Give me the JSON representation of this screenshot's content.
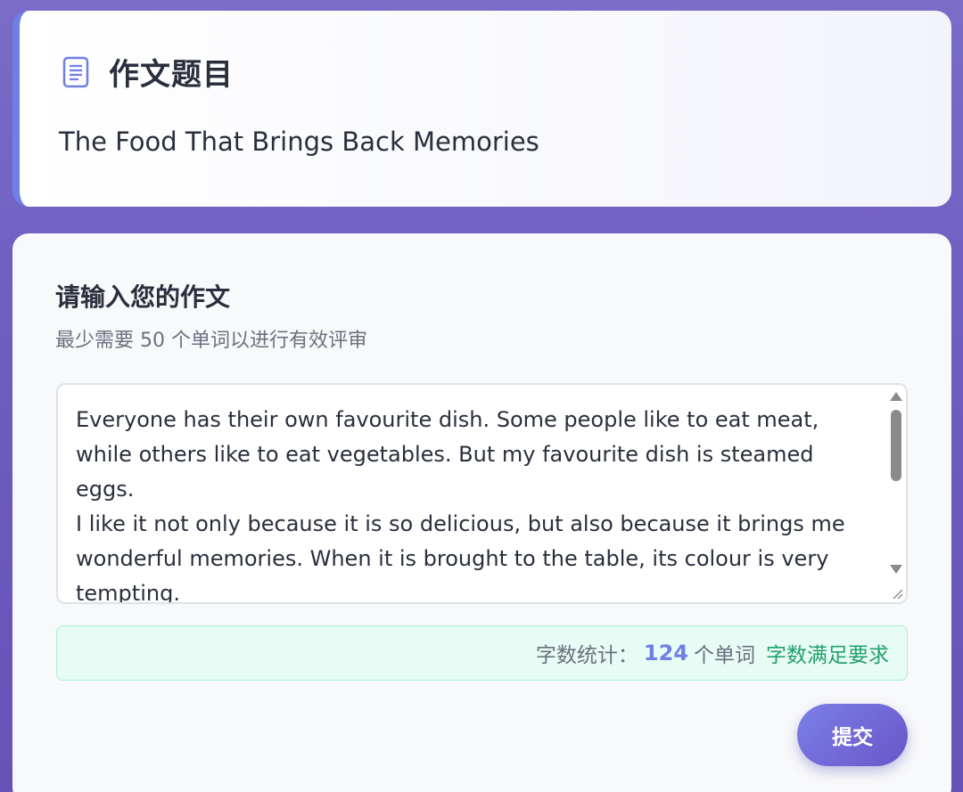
{
  "topic_card": {
    "heading": "作文题目",
    "topic": "The Food That Brings Back Memories",
    "icon": "document-icon"
  },
  "essay_card": {
    "title": "请输入您的作文",
    "hint": "最少需要 50 个单词以进行有效评审",
    "essay_text": "Everyone has their own favourite dish. Some people like to eat meat, while others like to eat vegetables. But my favourite dish is steamed eggs.\nI like it not only because it is so delicious, but also because it brings me wonderful memories. When it is brought to the table, its colour is very tempting.\nWhen I was little, my mum would make steamed eggs for me every morning",
    "word_count": {
      "label": "字数统计：",
      "count": "124",
      "unit": "个单词",
      "status": "字数满足要求"
    },
    "submit_label": "提交"
  },
  "colors": {
    "accent": "#6f7fe6",
    "success": "#22a06b",
    "background_gradient": [
      "#7a6cc8",
      "#6752b8"
    ]
  }
}
